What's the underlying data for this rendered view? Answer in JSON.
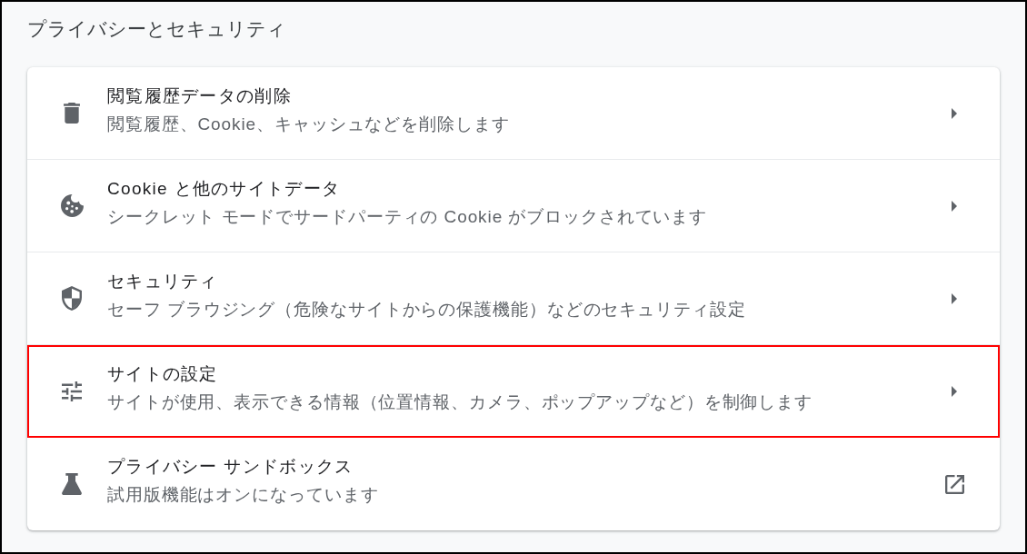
{
  "page": {
    "title": "プライバシーとセキュリティ"
  },
  "items": [
    {
      "title": "閲覧履歴データの削除",
      "description": "閲覧履歴、Cookie、キャッシュなどを削除します",
      "kind": "submenu",
      "highlighted": false
    },
    {
      "title": "Cookie と他のサイトデータ",
      "description": "シークレット モードでサードパーティの Cookie がブロックされています",
      "kind": "submenu",
      "highlighted": false
    },
    {
      "title": "セキュリティ",
      "description": "セーフ ブラウジング（危険なサイトからの保護機能）などのセキュリティ設定",
      "kind": "submenu",
      "highlighted": false
    },
    {
      "title": "サイトの設定",
      "description": "サイトが使用、表示できる情報（位置情報、カメラ、ポップアップなど）を制御します",
      "kind": "submenu",
      "highlighted": true
    },
    {
      "title": "プライバシー サンドボックス",
      "description": "試用版機能はオンになっています",
      "kind": "external",
      "highlighted": false
    }
  ]
}
